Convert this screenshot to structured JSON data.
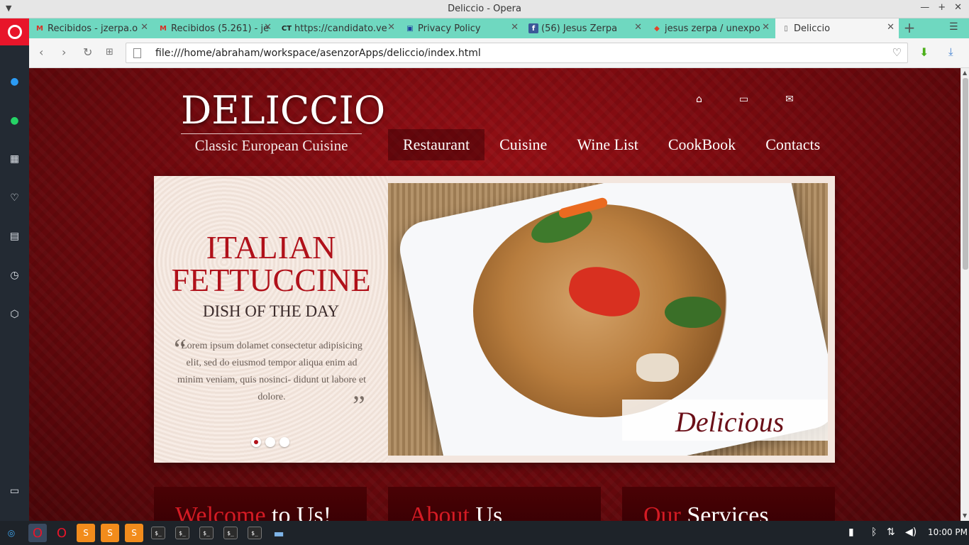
{
  "window": {
    "title": "Deliccio - Opera"
  },
  "tabs": [
    {
      "label": "Recibidos - jzerpa.o",
      "favicon": "M",
      "favicon_color": "#d93025",
      "active": false
    },
    {
      "label": "Recibidos (5.261) - je",
      "favicon": "M",
      "favicon_color": "#d93025",
      "active": false
    },
    {
      "label": "https://candidato.ve",
      "favicon": "CT",
      "favicon_color": "#222222",
      "active": false
    },
    {
      "label": "Privacy Policy",
      "favicon": "▣",
      "favicon_color": "#1f3f9e",
      "active": false
    },
    {
      "label": "(56) Jesus Zerpa",
      "favicon": "f",
      "favicon_color": "#3b5998",
      "active": false
    },
    {
      "label": "jesus zerpa / unexpo",
      "favicon": "◆",
      "favicon_color": "#e24329",
      "active": false
    },
    {
      "label": "Deliccio",
      "favicon": "▯",
      "favicon_color": "#666666",
      "active": true
    }
  ],
  "addressbar": {
    "url": "file:///home/abraham/workspace/asenzorApps/deliccio/index.html"
  },
  "sidebar": {
    "items": [
      "messenger-icon",
      "whatsapp-icon",
      "speed-dial-icon",
      "bookmarks-icon",
      "news-icon",
      "history-icon",
      "extensions-icon"
    ]
  },
  "site": {
    "brand": "DELICCIO",
    "tagline": "Classic European Cuisine",
    "nav": [
      "Restaurant",
      "Cuisine",
      "Wine List",
      "CookBook",
      "Contacts"
    ],
    "active_nav": "Restaurant",
    "slide": {
      "title_line1": "ITALIAN",
      "title_line2": "FETTUCCINE",
      "subtitle": "DISH OF THE DAY",
      "text": "Lorem ipsum dolamet consectetur adipisicing elit, sed do eiusmod tempor aliqua enim ad minim veniam, quis nosinci- didunt ut labore et dolore.",
      "caption": "Delicious",
      "dots": 3,
      "active_dot": 1
    },
    "boxes": [
      {
        "accent": "Welcome",
        "rest": " to Us!"
      },
      {
        "accent": "About",
        "rest": " Us"
      },
      {
        "accent": "Our",
        "rest": " Services"
      }
    ]
  },
  "taskbar": {
    "clock": "10:00 PM"
  },
  "colors": {
    "accent": "#b0111a",
    "tabbar": "#6fd8c0",
    "opera_red": "#e8152a"
  }
}
